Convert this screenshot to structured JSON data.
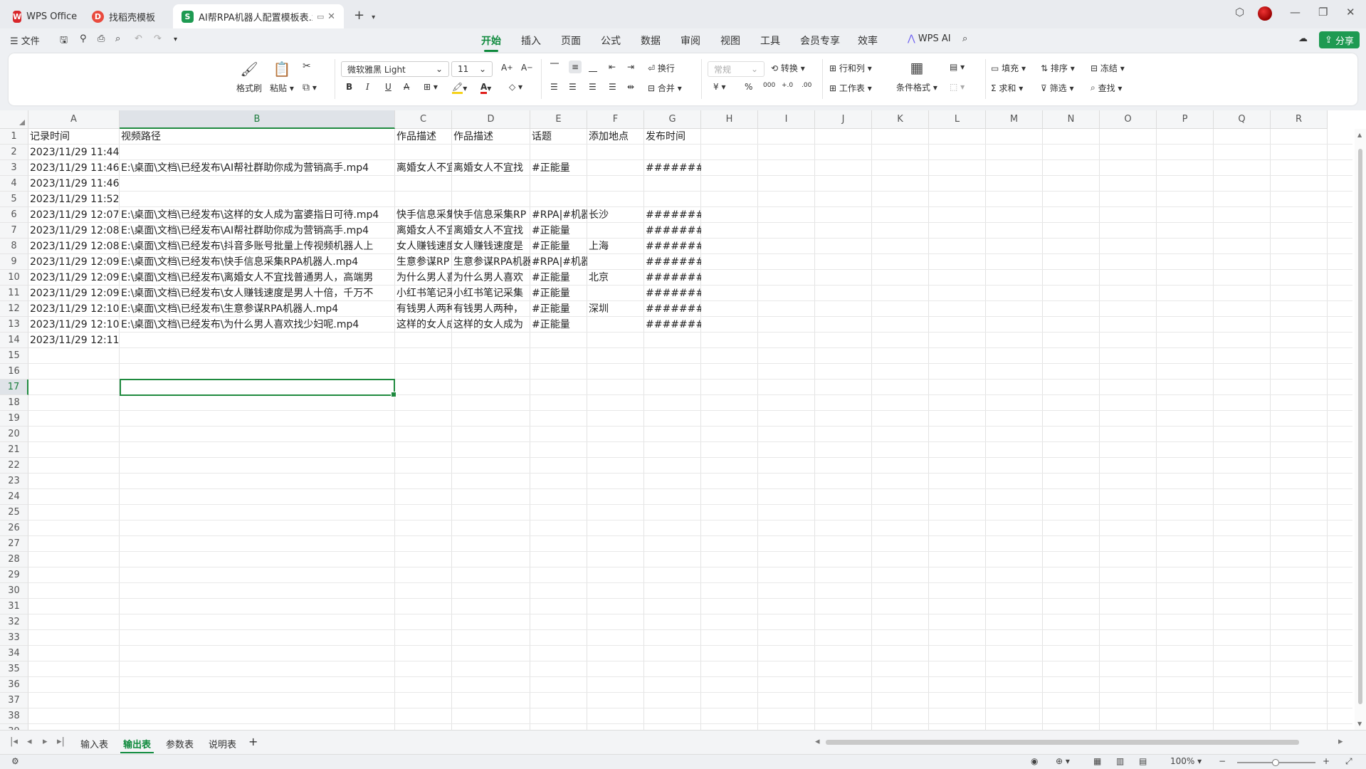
{
  "tabs": [
    {
      "label": "WPS Office",
      "icon": "wps-logo-icon"
    },
    {
      "label": "找稻壳模板",
      "icon": "docer-icon"
    },
    {
      "label": "AI帮RPA机器人配置模板表.xls",
      "icon": "sheet-file-icon"
    }
  ],
  "menu": {
    "file": "文件",
    "tabs": [
      "开始",
      "插入",
      "页面",
      "公式",
      "数据",
      "审阅",
      "视图",
      "工具",
      "会员专享",
      "效率"
    ],
    "active_tab": "开始",
    "wps_ai": "WPS AI",
    "share": "分享"
  },
  "ribbon": {
    "format_painter": "格式刷",
    "paste": "粘贴",
    "font_name": "微软雅黑 Light",
    "font_size": "11",
    "wrap": "换行",
    "merge": "合并",
    "number_format": "常规",
    "convert": "转换",
    "row_col": "行和列",
    "worksheet": "工作表",
    "conditional": "条件格式",
    "fill": "填充",
    "sort": "排序",
    "freeze": "冻结",
    "sum": "求和",
    "filter": "筛选",
    "find": "查找",
    "bold": "B",
    "italic": "I",
    "underline": "U",
    "currency": "¥",
    "percent": "%",
    "thousands": "000",
    "inc_decimal": "+.0",
    "dec_decimal": ".00"
  },
  "columns": [
    "A",
    "B",
    "C",
    "D",
    "E",
    "F",
    "G",
    "H",
    "I",
    "J",
    "K",
    "L",
    "M",
    "N",
    "O",
    "P",
    "Q",
    "R"
  ],
  "row_numbers": [
    "1",
    "2",
    "3",
    "4",
    "5",
    "6",
    "7",
    "8",
    "9",
    "10",
    "11",
    "12",
    "13",
    "14",
    "15",
    "16",
    "17",
    "18",
    "19",
    "20",
    "21",
    "22",
    "23",
    "24",
    "25",
    "26",
    "27",
    "28",
    "29",
    "30",
    "31",
    "32",
    "33",
    "34",
    "35",
    "36",
    "37",
    "38",
    "39"
  ],
  "headers": {
    "A": "记录时间",
    "B": "视频路径",
    "C": "作品描述",
    "D": "作品描述",
    "E": "话题",
    "F": "添加地点",
    "G": "发布时间"
  },
  "rows": [
    {
      "A": "2023/11/29 11:44",
      "B": "",
      "C": "",
      "D": "",
      "E": "",
      "F": "",
      "G": ""
    },
    {
      "A": "2023/11/29 11:46",
      "B": "E:\\桌面\\文档\\已经发布\\AI帮社群助你成为营销高手.mp4",
      "C": "离婚女人不宜",
      "D": "离婚女人不宜找",
      "E": "#正能量",
      "F": "",
      "G": "########"
    },
    {
      "A": "2023/11/29 11:46",
      "B": "",
      "C": "",
      "D": "",
      "E": "",
      "F": "",
      "G": ""
    },
    {
      "A": "2023/11/29 11:52",
      "B": "",
      "C": "",
      "D": "",
      "E": "",
      "F": "",
      "G": ""
    },
    {
      "A": "2023/11/29 12:07",
      "B": "E:\\桌面\\文档\\已经发布\\这样的女人成为富婆指日可待.mp4",
      "C": "快手信息采集",
      "D": "快手信息采集RP",
      "E": "#RPA|#机器",
      "F": "长沙",
      "G": "########"
    },
    {
      "A": "2023/11/29 12:08",
      "B": "E:\\桌面\\文档\\已经发布\\AI帮社群助你成为营销高手.mp4",
      "C": "离婚女人不宜",
      "D": "离婚女人不宜找",
      "E": "#正能量",
      "F": "",
      "G": "########"
    },
    {
      "A": "2023/11/29 12:08",
      "B": "E:\\桌面\\文档\\已经发布\\抖音多账号批量上传视频机器人上",
      "C": "女人赚钱速度",
      "D": "女人赚钱速度是",
      "E": "#正能量",
      "F": "上海",
      "G": "########"
    },
    {
      "A": "2023/11/29 12:09",
      "B": "E:\\桌面\\文档\\已经发布\\快手信息采集RPA机器人.mp4",
      "C": "生意参谋RP",
      "D": "生意参谋RPA机器",
      "E": "#RPA|#机器人",
      "F": "",
      "G": "########"
    },
    {
      "A": "2023/11/29 12:09",
      "B": "E:\\桌面\\文档\\已经发布\\离婚女人不宜找普通男人，高端男",
      "C": "为什么男人喜",
      "D": "为什么男人喜欢",
      "E": "#正能量",
      "F": "北京",
      "G": "########"
    },
    {
      "A": "2023/11/29 12:09",
      "B": "E:\\桌面\\文档\\已经发布\\女人赚钱速度是男人十倍，千万不",
      "C": "小红书笔记采",
      "D": "小红书笔记采集",
      "E": "#正能量",
      "F": "",
      "G": "########"
    },
    {
      "A": "2023/11/29 12:10",
      "B": "E:\\桌面\\文档\\已经发布\\生意参谋RPA机器人.mp4",
      "C": "有钱男人两种",
      "D": "有钱男人两种，",
      "E": "#正能量",
      "F": "深圳",
      "G": "########"
    },
    {
      "A": "2023/11/29 12:10",
      "B": "E:\\桌面\\文档\\已经发布\\为什么男人喜欢找少妇呢.mp4",
      "C": "这样的女人成",
      "D": "这样的女人成为",
      "E": "#正能量",
      "F": "",
      "G": "########"
    },
    {
      "A": "2023/11/29 12:11",
      "B": "",
      "C": "",
      "D": "",
      "E": "",
      "F": "",
      "G": ""
    }
  ],
  "sheet_tabs": [
    "输入表",
    "输出表",
    "参数表",
    "说明表"
  ],
  "active_sheet": "输出表",
  "status": {
    "zoom": "100%"
  },
  "colors": {
    "accent": "#0f8a3d",
    "share": "#1e9a52"
  }
}
